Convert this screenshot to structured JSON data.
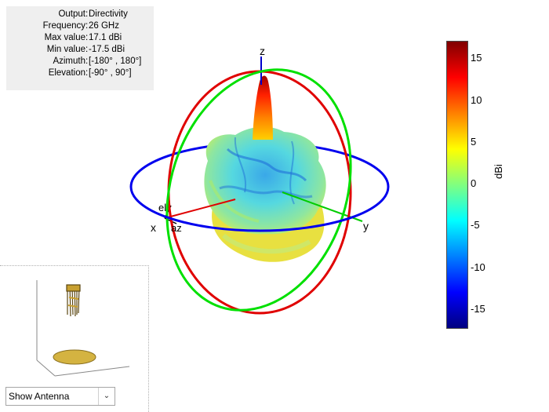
{
  "info": [
    {
      "label": "Output",
      "value": "Directivity"
    },
    {
      "label": "Frequency",
      "value": "26 GHz"
    },
    {
      "label": "Max value",
      "value": "17.1 dBi"
    },
    {
      "label": "Min value",
      "value": "-17.5 dBi"
    },
    {
      "label": "Azimuth",
      "value": "[-180° , 180°]"
    },
    {
      "label": "Elevation",
      "value": "[-90° , 90°]"
    }
  ],
  "axes": {
    "z": "z",
    "x": "x",
    "y": "y",
    "el": "el",
    "az": "az"
  },
  "colorbar": {
    "label": "dBi",
    "min": -17.5,
    "max": 17.1,
    "ticks": [
      "15",
      "10",
      "5",
      "0",
      "-5",
      "-10",
      "-15"
    ],
    "colors": [
      "#000080",
      "#0000ff",
      "#0080ff",
      "#00ffff",
      "#80ff80",
      "#ffff00",
      "#ff8000",
      "#ff0000",
      "#800000"
    ]
  },
  "preview": {
    "select_value": "Show Antenna",
    "ground_color": "#d4b341",
    "element_color": "#c8a030"
  },
  "rings": {
    "azimuth": "#0000ff",
    "elevation_xz": "#ff0000",
    "elevation_yz": "#00e000"
  }
}
